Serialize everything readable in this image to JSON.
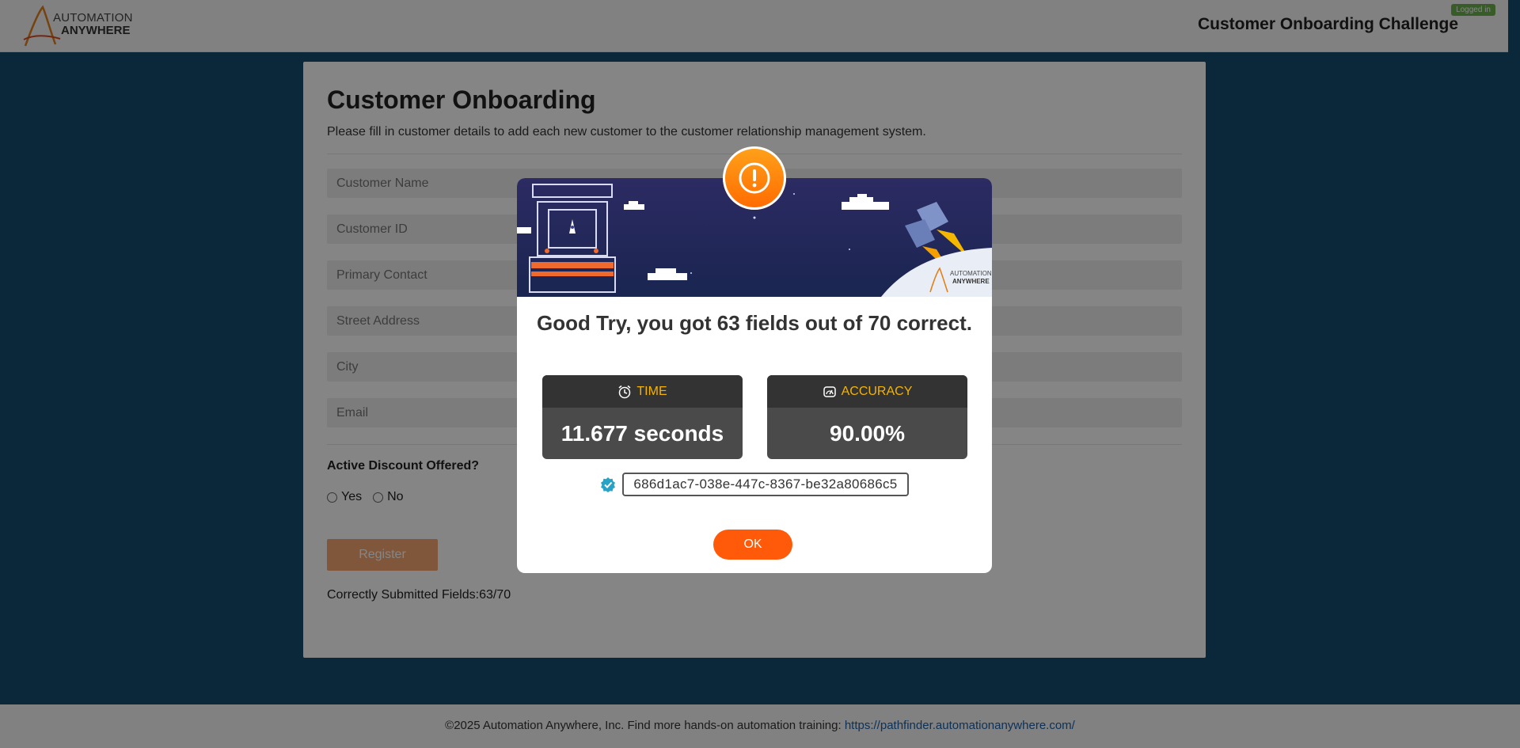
{
  "header": {
    "logo_line1": "AUTOMATION",
    "logo_line2": "ANYWHERE",
    "title": "Customer Onboarding Challenge",
    "login_badge": "Logged in"
  },
  "form": {
    "title": "Customer Onboarding",
    "subtitle": "Please fill in customer details to add each new customer to the customer relationship management system.",
    "fields": [
      {
        "placeholder": "Customer Name"
      },
      {
        "placeholder": "Customer ID"
      },
      {
        "placeholder": "Primary Contact"
      },
      {
        "placeholder": "Street Address"
      },
      {
        "placeholder": "City"
      },
      {
        "placeholder": "Email"
      }
    ],
    "discount_label": "Active Discount Offered?",
    "option_yes": "Yes",
    "option_no": "No",
    "register_label": "Register",
    "correct_fields": "Correctly Submitted Fields:63/70"
  },
  "footer": {
    "text": "©2025 Automation Anywhere, Inc. Find more hands-on automation training: ",
    "link": "https://pathfinder.automationanywhere.com/"
  },
  "modal": {
    "message": "Good Try, you got 63 fields out of 70 correct.",
    "time_label": "TIME",
    "time_value": "11.677 seconds",
    "accuracy_label": "ACCURACY",
    "accuracy_value": "90.00%",
    "code": "686d1ac7-038e-447c-8367-be32a80686c5",
    "ok_label": "OK",
    "banner_logo_line1": "AUTOMATION",
    "banner_logo_line2": "ANYWHERE"
  },
  "colors": {
    "page_bg": "#164d72",
    "accent_orange": "#ff5a0a",
    "stat_label": "#f5b301",
    "banner_dark": "#22255a"
  }
}
